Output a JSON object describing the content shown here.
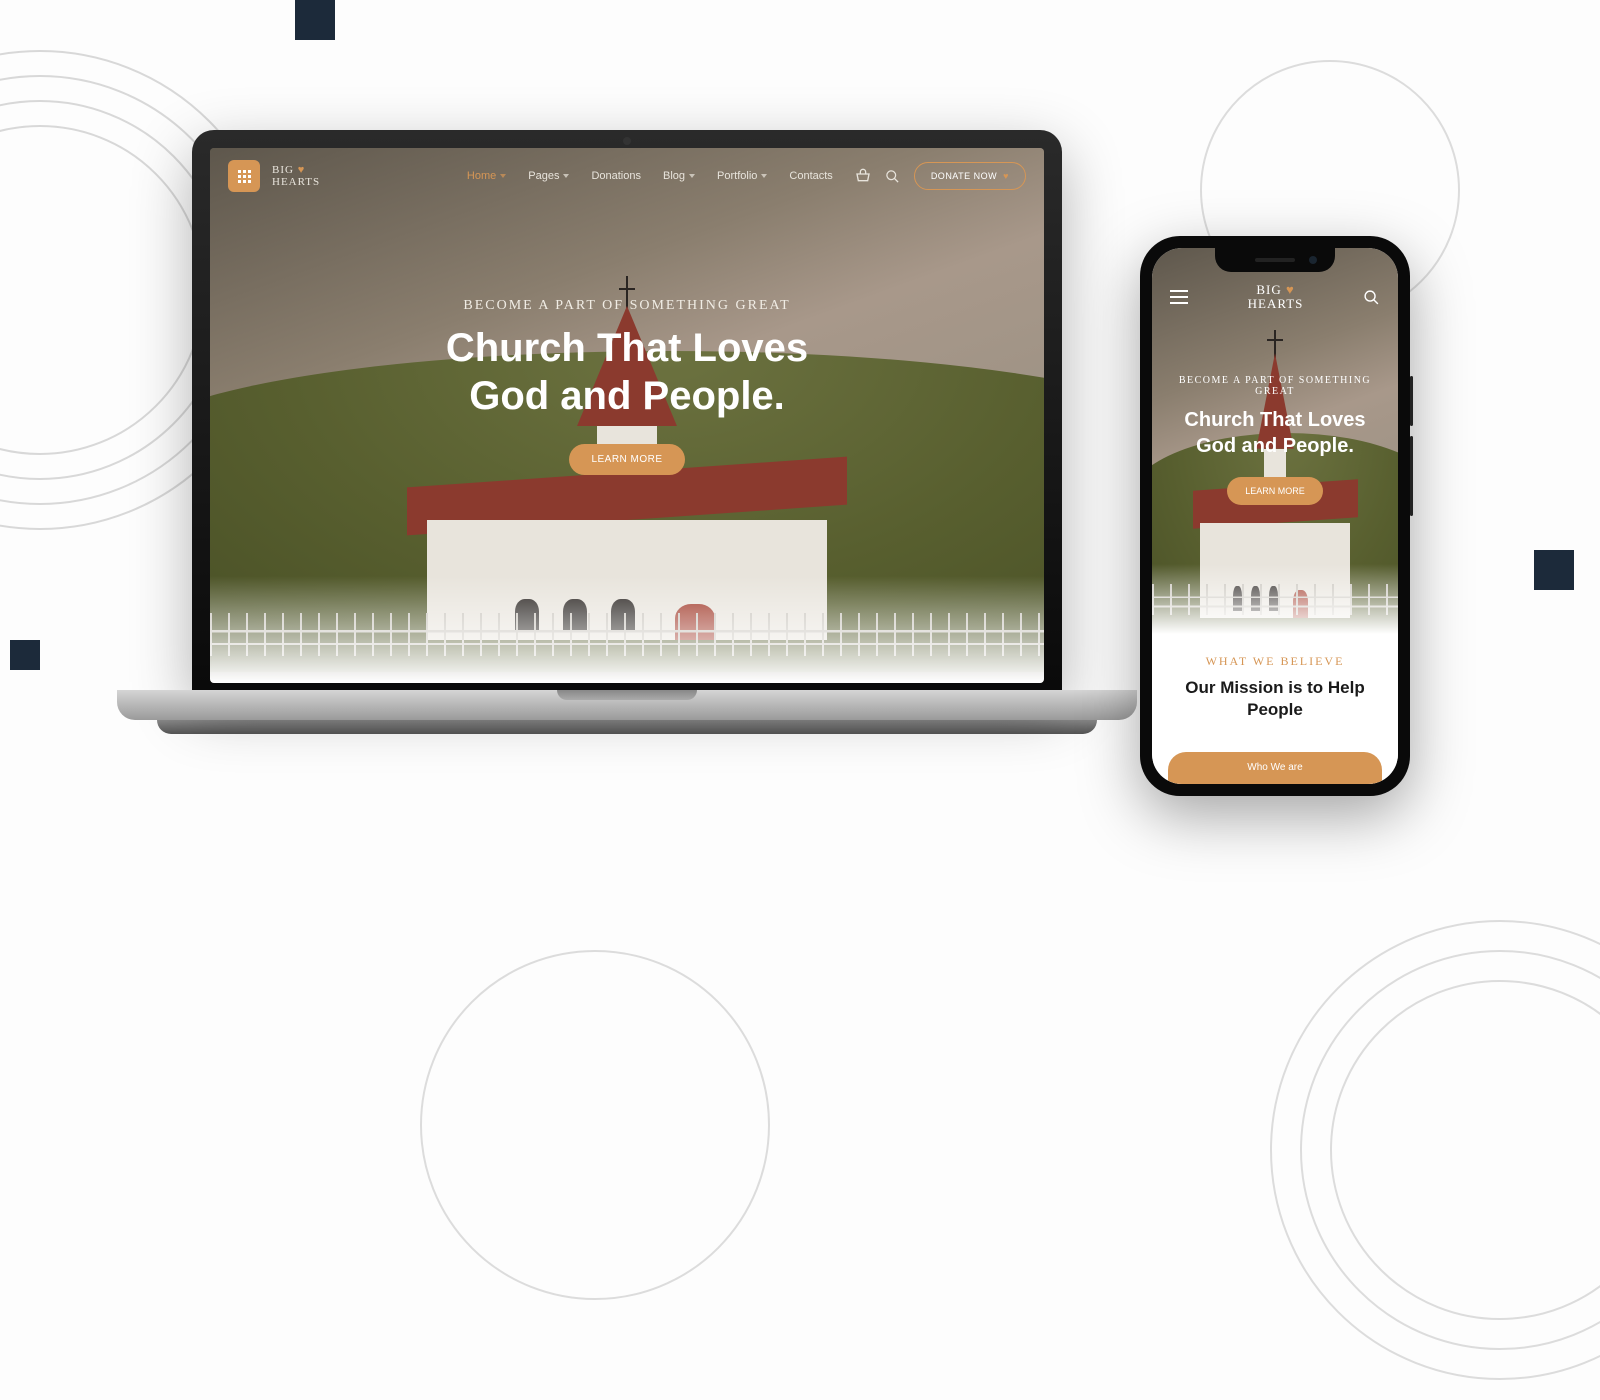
{
  "brand": {
    "line1": "BIG",
    "line2": "HEARTS",
    "heart": "♥"
  },
  "nav": {
    "items": [
      {
        "label": "Home",
        "active": true,
        "dropdown": true
      },
      {
        "label": "Pages",
        "active": false,
        "dropdown": true
      },
      {
        "label": "Donations",
        "active": false,
        "dropdown": false
      },
      {
        "label": "Blog",
        "active": false,
        "dropdown": true
      },
      {
        "label": "Portfolio",
        "active": false,
        "dropdown": true
      },
      {
        "label": "Contacts",
        "active": false,
        "dropdown": false
      }
    ],
    "donate_label": "DONATE NOW"
  },
  "hero": {
    "eyebrow": "BECOME A PART OF SOMETHING GREAT",
    "title_line1": "Church That Loves",
    "title_line2": "God and People.",
    "cta": "LEARN MORE"
  },
  "mobile": {
    "eyebrow": "BECOME A PART OF SOMETHING GREAT",
    "title_line1": "Church That Loves",
    "title_line2": "God and People.",
    "cta": "LEARN MORE",
    "section_eyebrow": "WHAT WE BELIEVE",
    "section_title_line1": "Our Mission is to Help",
    "section_title_line2": "People",
    "tab_label": "Who We are"
  },
  "colors": {
    "accent": "#d69655",
    "dark": "#1c2a3a"
  }
}
